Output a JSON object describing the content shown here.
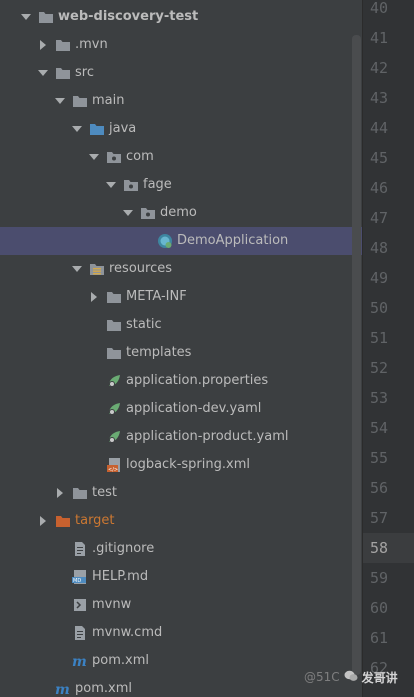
{
  "tree": [
    {
      "label": "web-discovery-test",
      "depth": 0,
      "arrow": "down",
      "icon": "module-folder",
      "bold": true
    },
    {
      "label": ".mvn",
      "depth": 1,
      "arrow": "right",
      "icon": "folder"
    },
    {
      "label": "src",
      "depth": 1,
      "arrow": "down",
      "icon": "folder"
    },
    {
      "label": "main",
      "depth": 2,
      "arrow": "down",
      "icon": "folder"
    },
    {
      "label": "java",
      "depth": 3,
      "arrow": "down",
      "icon": "source-folder"
    },
    {
      "label": "com",
      "depth": 4,
      "arrow": "down",
      "icon": "package"
    },
    {
      "label": "fage",
      "depth": 5,
      "arrow": "down",
      "icon": "package"
    },
    {
      "label": "demo",
      "depth": 6,
      "arrow": "down",
      "icon": "package"
    },
    {
      "label": "DemoApplication",
      "depth": 7,
      "arrow": "none",
      "icon": "spring-boot-class",
      "selected": true
    },
    {
      "label": "resources",
      "depth": 3,
      "arrow": "down",
      "icon": "resources-folder"
    },
    {
      "label": "META-INF",
      "depth": 4,
      "arrow": "right",
      "icon": "folder"
    },
    {
      "label": "static",
      "depth": 4,
      "arrow": "none",
      "icon": "folder"
    },
    {
      "label": "templates",
      "depth": 4,
      "arrow": "none",
      "icon": "folder"
    },
    {
      "label": "application.properties",
      "depth": 4,
      "arrow": "none",
      "icon": "spring-config"
    },
    {
      "label": "application-dev.yaml",
      "depth": 4,
      "arrow": "none",
      "icon": "spring-config"
    },
    {
      "label": "application-product.yaml",
      "depth": 4,
      "arrow": "none",
      "icon": "spring-config"
    },
    {
      "label": "logback-spring.xml",
      "depth": 4,
      "arrow": "none",
      "icon": "xml-file"
    },
    {
      "label": "test",
      "depth": 2,
      "arrow": "right",
      "icon": "folder"
    },
    {
      "label": "target",
      "depth": 1,
      "arrow": "right",
      "icon": "excluded-folder",
      "orange": true
    },
    {
      "label": ".gitignore",
      "depth": 2,
      "arrow": "none",
      "icon": "text-file"
    },
    {
      "label": "HELP.md",
      "depth": 2,
      "arrow": "none",
      "icon": "markdown-file"
    },
    {
      "label": "mvnw",
      "depth": 2,
      "arrow": "none",
      "icon": "script-file"
    },
    {
      "label": "mvnw.cmd",
      "depth": 2,
      "arrow": "none",
      "icon": "text-file"
    },
    {
      "label": "pom.xml",
      "depth": 2,
      "arrow": "none",
      "icon": "maven-file"
    },
    {
      "label": "pom.xml",
      "depth": 1,
      "arrow": "none",
      "icon": "maven-file"
    }
  ],
  "gutter": {
    "lines": [
      "40",
      "41",
      "42",
      "43",
      "44",
      "45",
      "46",
      "47",
      "48",
      "49",
      "50",
      "51",
      "52",
      "53",
      "54",
      "55",
      "56",
      "57",
      "58",
      "59",
      "60",
      "61",
      "62"
    ],
    "current": "58"
  },
  "watermark": {
    "site": "@51C",
    "name": "发哥讲"
  },
  "colors": {
    "panel_bg": "#3c3f41",
    "selection": "#4b4d6e",
    "folder": "#8f949a",
    "source_folder": "#4e8bbf",
    "excluded_folder": "#c7612f",
    "spring_green": "#6aab73",
    "maven_blue": "#3b82c4"
  }
}
